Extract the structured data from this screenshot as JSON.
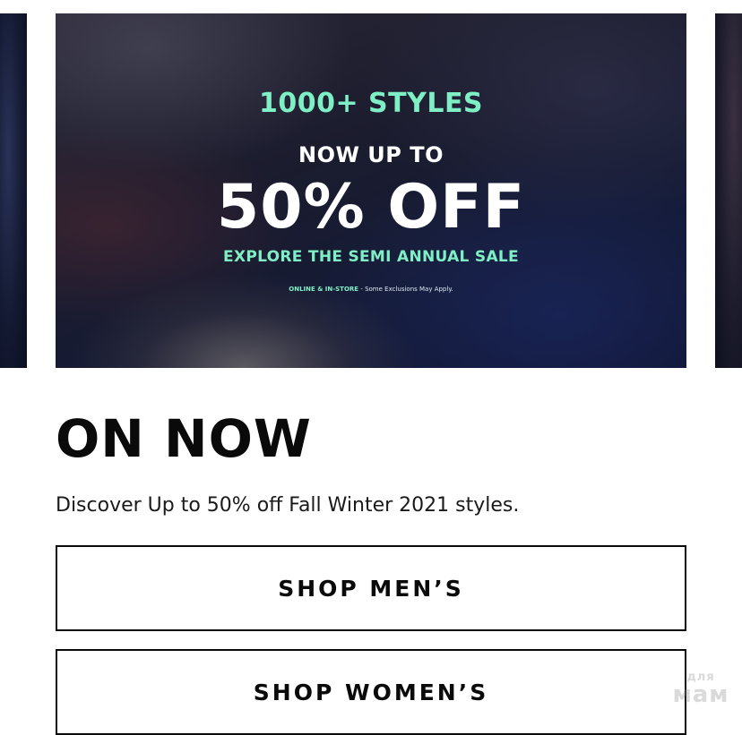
{
  "banner": {
    "headline": "1000+ STYLES",
    "subhead": "NOW UP TO",
    "discount": "50% OFF",
    "cta": "EXPLORE THE SEMI ANNUAL SALE",
    "fine_print_strong": "ONLINE & IN-STORE",
    "fine_print": " - Some Exclusions May Apply.",
    "accent_color": "#7ff0c6"
  },
  "section": {
    "title": "ON NOW",
    "description": "Discover Up to 50% off Fall Winter 2021 styles."
  },
  "buttons": {
    "mens": "SHOP MEN’S",
    "womens": "SHOP WOMEN’S"
  },
  "watermark": {
    "top": "для",
    "bottom": "мам"
  }
}
